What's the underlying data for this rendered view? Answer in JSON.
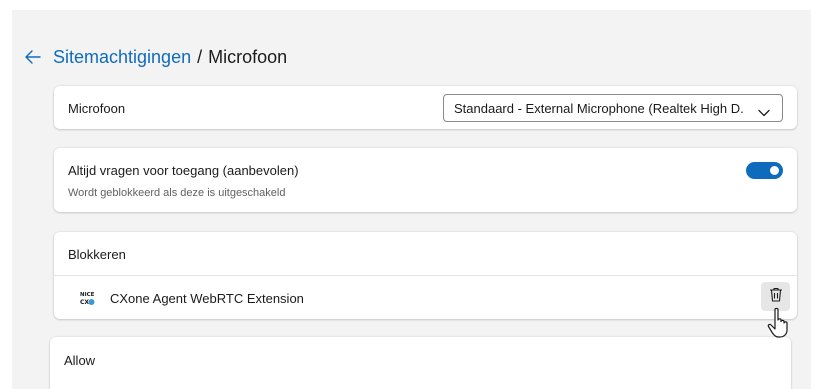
{
  "header": {
    "back_icon": "arrow-left-icon",
    "breadcrumb_parent": "Sitemachtigingen",
    "separator": "/",
    "breadcrumb_current": "Microfoon"
  },
  "microphone": {
    "label": "Microfoon",
    "selected_device": "Standaard - External Microphone (Realtek High D...",
    "dropdown_icon": "chevron-down-icon"
  },
  "ask_access": {
    "label": "Altijd vragen voor toegang (aanbevolen)",
    "description": "Wordt geblokkeerd als deze is uitgeschakeld",
    "enabled": true
  },
  "block": {
    "title": "Blokkeren",
    "sites": [
      {
        "name": "CXone Agent WebRTC Extension",
        "icon": "nice-cxone-icon",
        "icon_text_top": "NICE",
        "icon_text_bottom": "CX",
        "delete_icon": "trash-icon"
      }
    ]
  },
  "allow": {
    "title": "Allow"
  },
  "colors": {
    "accent": "#0f6cbd",
    "page_background": "#f3f3f3",
    "card_background": "#ffffff"
  }
}
